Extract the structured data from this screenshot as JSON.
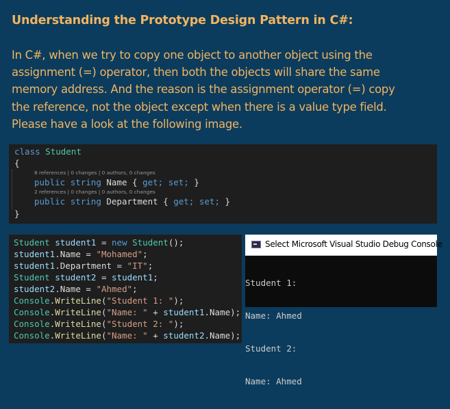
{
  "heading": "Understanding the Prototype Design Pattern in C#:",
  "paragraph": [
    "In C#, when we try to copy one object to another object using the",
    "assignment (=) operator, then both the objects will share the same",
    "memory address. And the reason is the assignment operator (=) copy",
    "the reference, not the object except when there is a value type field.",
    "Please have a look at the following image."
  ],
  "class_code": {
    "class_keyword": "class",
    "class_name": "Student",
    "open_brace": "{",
    "close_brace": "}",
    "lens1": "8 references | 0 changes | 0 authors, 0 changes",
    "lens2": "2 references | 0 changes | 0 authors, 0 changes",
    "public_kw": "public",
    "string_kw": "string",
    "prop1": "Name",
    "prop2": "Department",
    "accessor_open": "{",
    "get_kw": "get;",
    "set_kw": "set;",
    "accessor_close": "}"
  },
  "main_code": {
    "l1": {
      "type": "Student",
      "var": "student1",
      "eq": " = ",
      "new_kw": "new",
      "type2": "Student",
      "end": "();"
    },
    "l2": {
      "var": "student1",
      "rest": ".Name = ",
      "str": "\"Mohamed\"",
      "end": ";"
    },
    "l3": {
      "var": "student1",
      "rest": ".Department = ",
      "str": "\"IT\"",
      "end": ";"
    },
    "l4": {
      "type": "Student",
      "var": "student2",
      "eq": " = ",
      "var2": "student1",
      "end": ";"
    },
    "l5": {
      "var": "student2",
      "rest": ".Name = ",
      "str": "\"Ahmed\"",
      "end": ";"
    },
    "l6": {
      "cls": "Console",
      "dot": ".",
      "method": "WriteLine",
      "open": "(",
      "str": "\"Student 1: \"",
      "end": ");"
    },
    "l7": {
      "cls": "Console",
      "dot": ".",
      "method": "WriteLine",
      "open": "(",
      "str": "\"Name: \"",
      "plus": " + ",
      "var": "student1",
      "prop": ".Name",
      "end": ");"
    },
    "l8": {
      "cls": "Console",
      "dot": ".",
      "method": "WriteLine",
      "open": "(",
      "str": "\"Student 2: \"",
      "end": ");"
    },
    "l9": {
      "cls": "Console",
      "dot": ".",
      "method": "WriteLine",
      "open": "(",
      "str": "\"Name: \"",
      "plus": " + ",
      "var": "student2",
      "prop": ".Name",
      "end": ");"
    }
  },
  "console": {
    "title": "Select Microsoft Visual Studio Debug Console",
    "lines": [
      "Student 1:",
      "Name: Ahmed",
      "Student 2:",
      "Name: Ahmed"
    ]
  },
  "icons": {
    "console_window": "console-window-icon"
  }
}
